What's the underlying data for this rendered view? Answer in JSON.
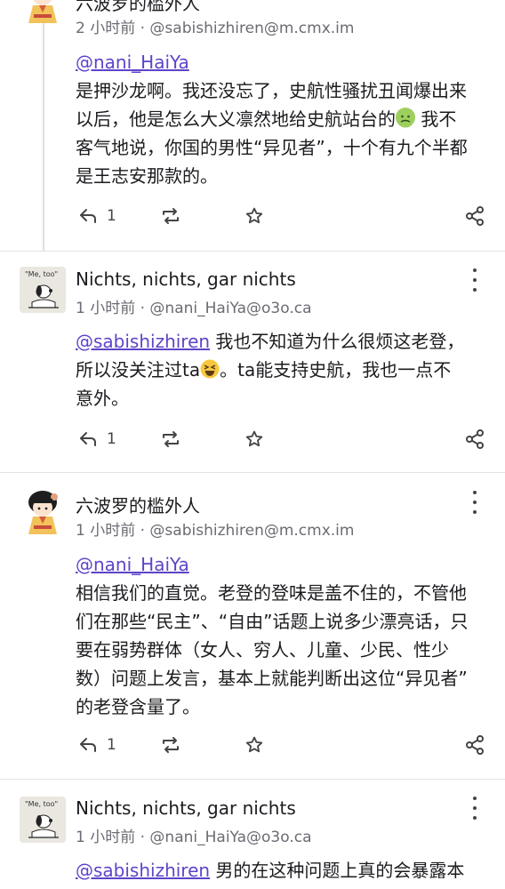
{
  "posts": [
    {
      "author": "六波罗的槛外人",
      "meta": "2 小时前 · @sabishizhiren@m.cmx.im",
      "mention": "@nani_HaiYa",
      "lines": [
        "是押沙龙啊。我还没忘了，史航性骚扰丑闻爆出来",
        "以后，他是怎么大义凛然地给史航站台的",
        "客气地说，你国的男性“异见者”，十个有九个半都",
        "是王志安那款的。"
      ],
      "line2_tail": "我不",
      "emoji": "nauseated-face-emoji",
      "reply_count": "1"
    },
    {
      "author": "Nichts, nichts, gar nichts",
      "meta": "1 小时前 · @nani_HaiYa@o3o.ca",
      "mention": "@sabishizhiren",
      "line1_rest": " 我也不知道为什么很烦这老登，",
      "line2_head": "所以没关注过ta",
      "line2_tail": "。ta能支持史航，我也一点不",
      "line3": "意外。",
      "emoji": "grinning-squinting-face-emoji",
      "reply_count": "1"
    },
    {
      "author": "六波罗的槛外人",
      "meta": "1 小时前 · @sabishizhiren@m.cmx.im",
      "mention": "@nani_HaiYa",
      "lines": [
        "相信我们的直觉。老登的登味是盖不住的，不管他",
        "们在那些“民主”、“自由”话题上说多少漂亮话，只",
        "要在弱势群体（女人、穷人、儿童、少民、性少",
        "数）问题上发言，基本上就能判断出这位“异见者”",
        "的老登含量了。"
      ],
      "reply_count": "1"
    },
    {
      "author": "Nichts, nichts, gar nichts",
      "meta": "1 小时前 · @nani_HaiYa@o3o.ca",
      "mention": "@sabishizhiren",
      "line1_rest": " 男的在这种问题上真的会暴露本"
    }
  ],
  "avatar_note": "\"Me, too\"",
  "colors": {
    "accent": "#5e44c9",
    "text": "#1c1b1f",
    "meta": "#6d6a73",
    "thread_line": "#e2dbe8"
  }
}
